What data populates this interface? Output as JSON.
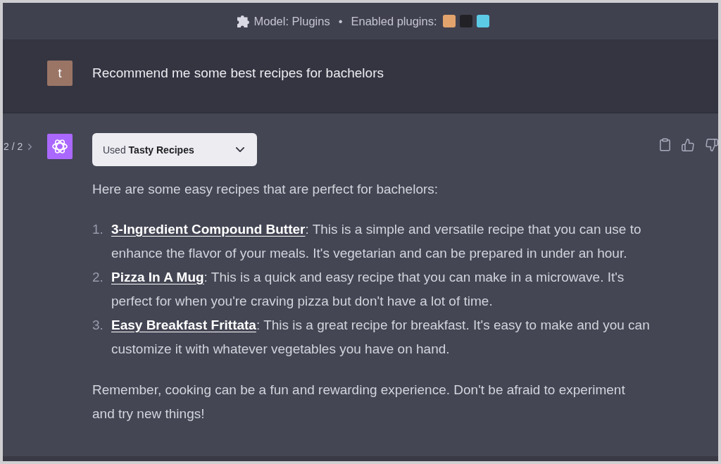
{
  "header": {
    "model": "Model: Plugins",
    "separator": "•",
    "plugins_label": "Enabled plugins:",
    "plugins": [
      {
        "color": "#e2a36c"
      },
      {
        "color": "#222226"
      },
      {
        "color": "#5ccbe6"
      }
    ]
  },
  "user_message": {
    "avatar": "t",
    "text": "Recommend me some best recipes for bachelors"
  },
  "assistant_message": {
    "pager": "2 / 2",
    "plugin_used": {
      "label": "Used **Tasty Recipes**",
      "expanded": false
    },
    "intro": "Here are some easy recipes that are perfect for bachelors:",
    "recipes": [
      {
        "number": "1.",
        "title": "3-Ingredient Compound Butter",
        "description": ": This is a simple and versatile recipe that you can use to enhance the flavor of your meals. It's vegetarian and can be prepared in under an hour."
      },
      {
        "number": "2.",
        "title": "Pizza In A Mug",
        "description": ": This is a quick and easy recipe that you can make in a microwave. It's perfect for when you're craving pizza but don't have a lot of time."
      },
      {
        "number": "3.",
        "title": "Easy Breakfast Frittata",
        "description": ": This is a great recipe for breakfast. It's easy to make and you can customize it with whatever vegetables you have on hand."
      }
    ],
    "closing": "Remember, cooking can be a fun and rewarding experience. Don't be afraid to experiment and try new things!"
  }
}
